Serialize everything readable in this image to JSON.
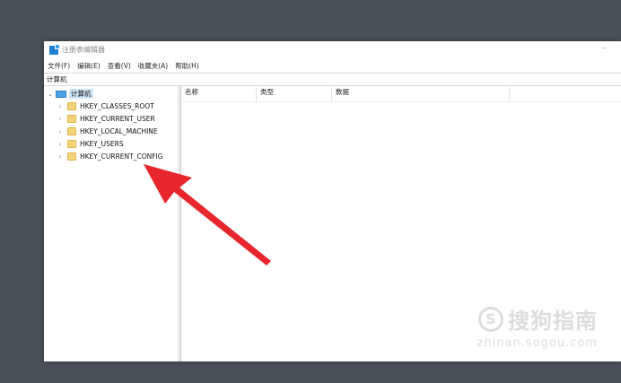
{
  "window": {
    "title": "注册表编辑器",
    "minimize_glyph": "–"
  },
  "menubar": {
    "items": [
      {
        "label": "文件(F)"
      },
      {
        "label": "编辑(E)"
      },
      {
        "label": "查看(V)"
      },
      {
        "label": "收藏夹(A)"
      },
      {
        "label": "帮助(H)"
      }
    ]
  },
  "addressbar": {
    "path": "计算机"
  },
  "tree": {
    "root": {
      "label": "计算机",
      "expanded": true
    },
    "children": [
      {
        "label": "HKEY_CLASSES_ROOT"
      },
      {
        "label": "HKEY_CURRENT_USER"
      },
      {
        "label": "HKEY_LOCAL_MACHINE"
      },
      {
        "label": "HKEY_USERS"
      },
      {
        "label": "HKEY_CURRENT_CONFIG"
      }
    ],
    "chevron_collapsed": "›",
    "chevron_expanded": "⌄"
  },
  "list": {
    "columns": [
      {
        "label": "名称"
      },
      {
        "label": "类型"
      },
      {
        "label": "数据"
      }
    ]
  },
  "annotation": {
    "arrow_color": "#e8262d"
  },
  "watermark": {
    "logo_glyph": "S",
    "text": "搜狗指南",
    "subtext": "zhinan.sogou.com"
  }
}
